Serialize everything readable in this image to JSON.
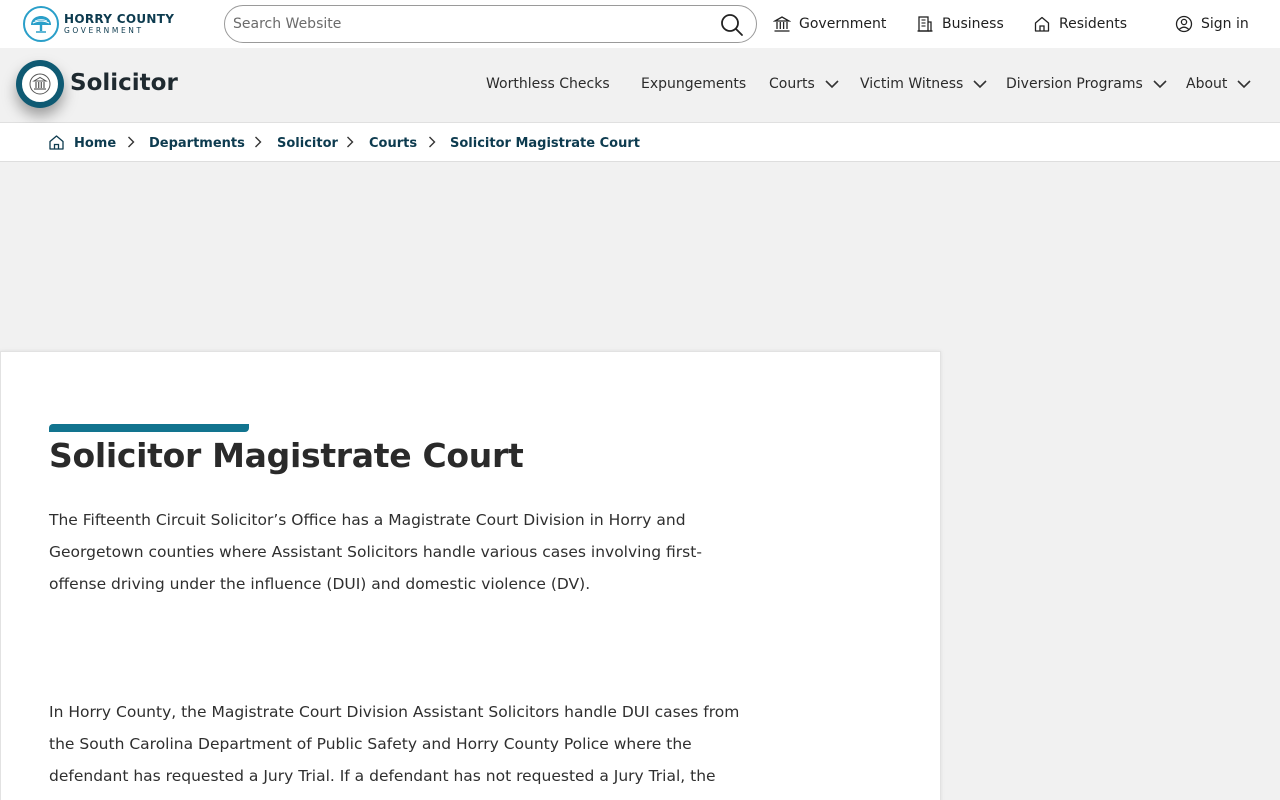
{
  "header": {
    "logo_line1": "HORRY COUNTY",
    "logo_line2": "GOVERNMENT",
    "search_placeholder": "Search Website",
    "links": [
      {
        "label": "Government",
        "icon": "government-building-icon"
      },
      {
        "label": "Business",
        "icon": "office-building-icon"
      },
      {
        "label": "Residents",
        "icon": "house-icon"
      },
      {
        "label": "Sign in",
        "icon": "user-circle-icon"
      }
    ]
  },
  "department": {
    "title": "Solicitor",
    "nav": [
      {
        "label": "Worthless Checks",
        "dropdown": false
      },
      {
        "label": "Expungements",
        "dropdown": false
      },
      {
        "label": "Courts",
        "dropdown": true
      },
      {
        "label": "Victim Witness",
        "dropdown": true
      },
      {
        "label": "Diversion Programs",
        "dropdown": true
      },
      {
        "label": "About",
        "dropdown": true
      }
    ]
  },
  "breadcrumb": {
    "items": [
      "Home",
      "Departments",
      "Solicitor",
      "Courts",
      "Solicitor Magistrate Court"
    ]
  },
  "content": {
    "title": "Solicitor Magistrate Court",
    "para1": "The Fifteenth Circuit Solicitor’s Office has a Magistrate Court Division in Horry and Georgetown counties where Assistant Solicitors handle various cases involving first-offense driving under the influence (DUI) and domestic violence (DV).",
    "para2": "In Horry County, the Magistrate Court Division Assistant Solicitors handle DUI cases from the South Carolina Department of Public Safety and Horry County Police where the defendant has requested a Jury Trial. If a defendant has not requested a Jury Trial, the"
  },
  "colors": {
    "accent": "#12748f",
    "brand_dark": "#0d3b4f",
    "logo_blue": "#2a9fc9"
  }
}
